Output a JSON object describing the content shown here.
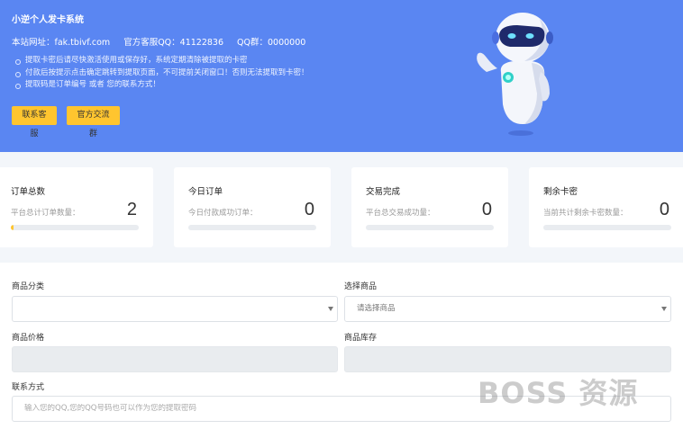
{
  "hero": {
    "title": "小逆个人发卡系统",
    "site_label": "本站网址：fak.tbivf.com",
    "qq_service": "官方客服QQ：41122836",
    "qq_group": "QQ群：0000000",
    "tips": [
      "提取卡密后请尽快激活使用或保存好，系统定期清除被提取的卡密",
      "付款后按提示点击确定跳转到提取页面，不可提前关闭窗口！否则无法提取到卡密！",
      "提取码是订单编号 或者 您的联系方式！"
    ],
    "buttons": {
      "service": "联系客服",
      "group": "官方交流群"
    },
    "accent": "#5a86f2",
    "button_color": "#ffc52f"
  },
  "stats": [
    {
      "title": "订单总数",
      "desc": "平台总计订单数量：",
      "value": "2",
      "progress": 0.02
    },
    {
      "title": "今日订单",
      "desc": "今日付款成功订单：",
      "value": "0",
      "progress": 0
    },
    {
      "title": "交易完成",
      "desc": "平台总交易成功量：",
      "value": "0",
      "progress": 0
    },
    {
      "title": "剩余卡密",
      "desc": "当前共计剩余卡密数量：",
      "value": "0",
      "progress": 0
    }
  ],
  "form": {
    "category_label": "商品分类",
    "category_value": "",
    "product_label": "选择商品",
    "product_value": "请选择商品",
    "price_label": "商品价格",
    "stock_label": "商品库存",
    "contact_label": "联系方式",
    "contact_placeholder": "输入您的QQ,您的QQ号码也可以作为您的提取密码"
  },
  "watermark": "BOSS 资源"
}
